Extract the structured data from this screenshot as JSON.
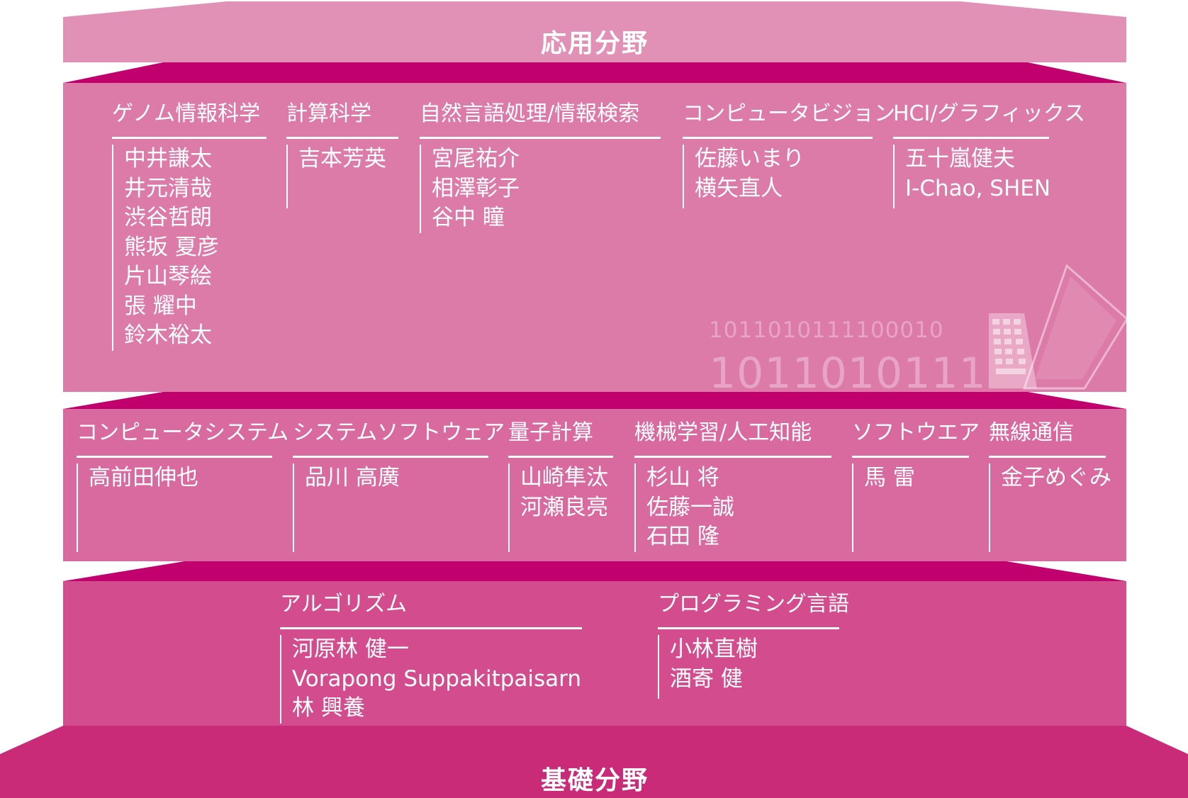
{
  "top_band": {
    "title": "応用分野"
  },
  "bottom_band": {
    "title": "基礎分野"
  },
  "decoration": {
    "binary_line_1": "1011010111100010",
    "binary_line_2": "1011010111",
    "icon": "laptop-icon"
  },
  "colors": {
    "top_band": "#e191b6",
    "application_panel": "#dc7aa8",
    "middle_panel": "#d86aa0",
    "foundation_panel": "#d34d8e",
    "base_band": "#c92b78",
    "connector": "#c2006d"
  },
  "application_fields": [
    {
      "name": "ゲノム情報科学",
      "members": [
        "中井謙太",
        "井元清哉",
        "渋谷哲朗",
        "熊坂 夏彦",
        "片山琴絵",
        "張 耀中",
        "鈴木裕太"
      ]
    },
    {
      "name": "計算科学",
      "members": [
        "吉本芳英"
      ]
    },
    {
      "name": "自然言語処理/情報検索",
      "members": [
        "宮尾祐介",
        "相澤彰子",
        "谷中 瞳"
      ]
    },
    {
      "name": "コンピュータビジョン",
      "members": [
        "佐藤いまり",
        "横矢直人"
      ]
    },
    {
      "name": "HCI/グラフィックス",
      "members": [
        "五十嵐健夫",
        "I-Chao, SHEN"
      ]
    }
  ],
  "system_fields": [
    {
      "name": "コンピュータシステム",
      "members": [
        "高前田伸也"
      ]
    },
    {
      "name": "システムソフトウェア",
      "members": [
        "品川 高廣"
      ]
    },
    {
      "name": "量子計算",
      "members": [
        "山崎隼汰",
        "河瀬良亮"
      ]
    },
    {
      "name": "機械学習/人工知能",
      "members": [
        "杉山 将",
        "佐藤一誠",
        "石田 隆"
      ]
    },
    {
      "name": "ソフトウエア",
      "members": [
        "馬 雷"
      ]
    },
    {
      "name": "無線通信",
      "members": [
        "金子めぐみ"
      ]
    }
  ],
  "foundation_fields": [
    {
      "name": "アルゴリズム",
      "members": [
        "河原林 健一",
        "Vorapong Suppakitpaisarn",
        "林 興養"
      ]
    },
    {
      "name": "プログラミング言語",
      "members": [
        "小林直樹",
        "酒寄 健"
      ]
    }
  ]
}
